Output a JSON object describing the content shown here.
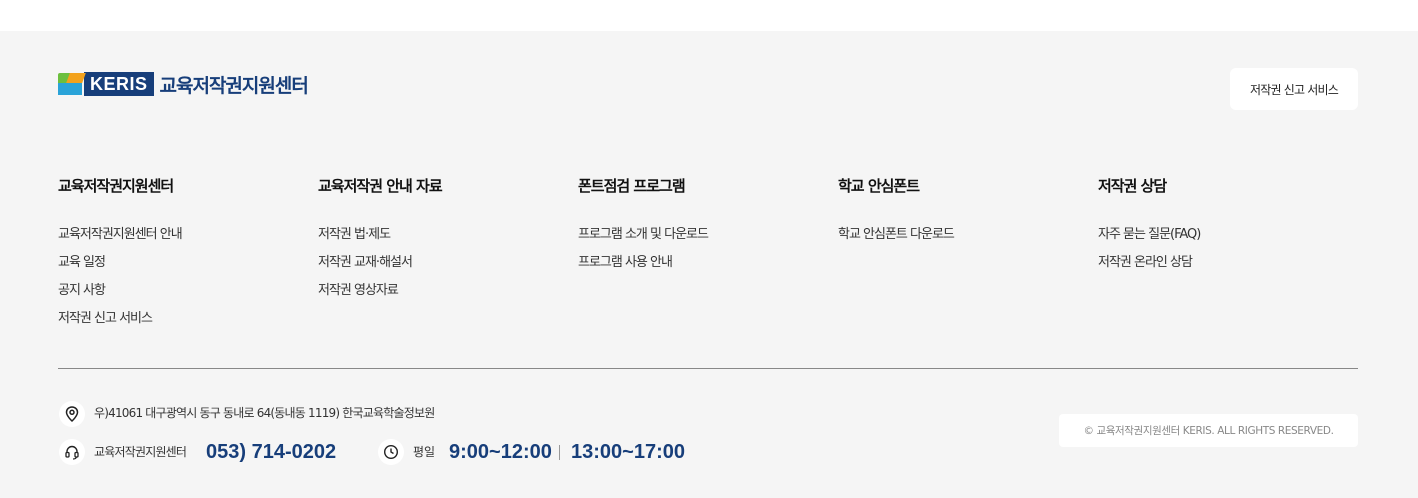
{
  "logo": {
    "brand": "KERIS",
    "title": "교육저작권지원센터"
  },
  "header": {
    "report_button": "저작권 신고 서비스"
  },
  "columns": [
    {
      "title": "교육저작권지원센터",
      "links": [
        "교육저작권지원센터 안내",
        "교육 일정",
        "공지 사항",
        "저작권 신고 서비스"
      ]
    },
    {
      "title": "교육저작권 안내 자료",
      "links": [
        "저작권 법·제도",
        "저작권 교재·해설서",
        "저작권 영상자료"
      ]
    },
    {
      "title": "폰트점검 프로그램",
      "links": [
        "프로그램 소개 및 다운로드",
        "프로그램 사용 안내"
      ]
    },
    {
      "title": "학교 안심폰트",
      "links": [
        "학교 안심폰트 다운로드"
      ]
    },
    {
      "title": "저작권 상담",
      "links": [
        "자주 묻는 질문(FAQ)",
        "저작권 온라인 상담"
      ]
    }
  ],
  "info": {
    "address": "우)41061 대구광역시 동구 동내로 64(동내동 1119) 한국교육학술정보원",
    "contact_label": "교육저작권지원센터",
    "phone": "053) 714-0202",
    "weekday_label": "평일",
    "hours_morning": "9:00~12:00",
    "hours_afternoon": "13:00~17:00"
  },
  "copyright": "© 교육저작권지원센터 KERIS. ALL RIGHTS RESERVED.",
  "icons": [
    "location-icon",
    "headset-icon",
    "clock-icon"
  ],
  "colors": {
    "brand_navy": "#173e7a",
    "footer_bg": "#f5f5f5"
  }
}
